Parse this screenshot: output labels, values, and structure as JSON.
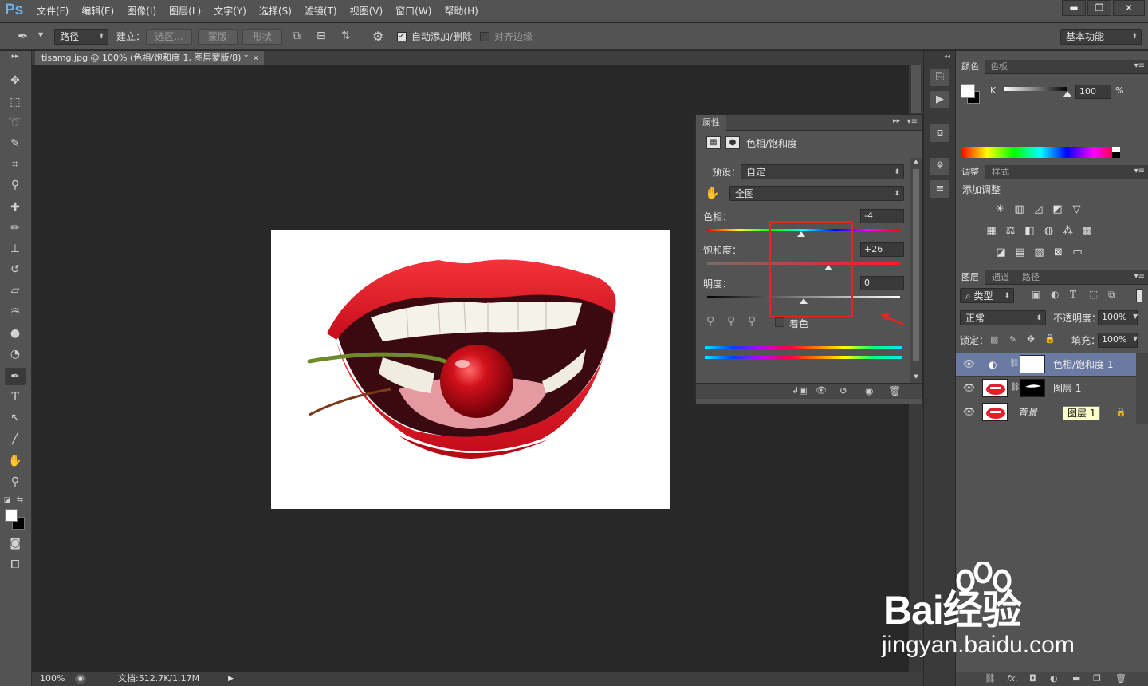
{
  "app": {
    "logo": "Ps",
    "menu": [
      "文件(F)",
      "编辑(E)",
      "图像(I)",
      "图层(L)",
      "文字(Y)",
      "选择(S)",
      "滤镜(T)",
      "视图(V)",
      "窗口(W)",
      "帮助(H)"
    ],
    "window_controls": [
      "▬",
      "❐",
      "✕"
    ]
  },
  "options": {
    "mode_value": "路径",
    "make_label": "建立：",
    "selection_btn": "选区...",
    "mask_btn": "蒙版",
    "shape_btn": "形状",
    "auto_add_label": "自动添加/删除",
    "auto_add_checked": true,
    "align_edges_label": "对齐边缘",
    "align_edges_checked": false,
    "workspace": "基本功能"
  },
  "document": {
    "tab_title": "tisamg.jpg @ 100% (色相/饱和度 1, 图层蒙版/8) *",
    "tab_close": "×",
    "zoom": "100%",
    "doc_info": "文档:512.7K/1.17M"
  },
  "properties": {
    "tab": "属性",
    "title": "色相/饱和度",
    "preset_label": "预设：",
    "preset_value": "自定",
    "channel_value": "全图",
    "hue_label": "色相：",
    "hue_value": "-4",
    "hue_num": -4,
    "saturation_label": "饱和度：",
    "saturation_value": "+26",
    "saturation_num": 26,
    "lightness_label": "明度：",
    "lightness_value": "0",
    "lightness_num": 0,
    "colorize_label": "着色",
    "colorize_checked": false
  },
  "color_panel": {
    "tabs": [
      "颜色",
      "色板"
    ],
    "channel_label": "K",
    "value": "100",
    "unit": "%"
  },
  "adjustments": {
    "tabs": [
      "调整",
      "样式"
    ],
    "title": "添加调整"
  },
  "layers": {
    "tabs": [
      "图层",
      "通道",
      "路径"
    ],
    "filter_label": "类型",
    "blend_mode": "正常",
    "opacity_label": "不透明度：",
    "opacity_value": "100%",
    "lock_label": "锁定：",
    "fill_label": "填充：",
    "fill_value": "100%",
    "items": [
      {
        "name": "色相/饱和度 1"
      },
      {
        "name": "图层 1"
      },
      {
        "name": "背景",
        "tooltip": "图层 1"
      }
    ]
  },
  "watermark": {
    "line1": "Bai经验",
    "line2": "jingyan.baidu.com"
  },
  "colors": {
    "accent_red": "#e3261f",
    "selected_layer": "#6b7aa3"
  }
}
